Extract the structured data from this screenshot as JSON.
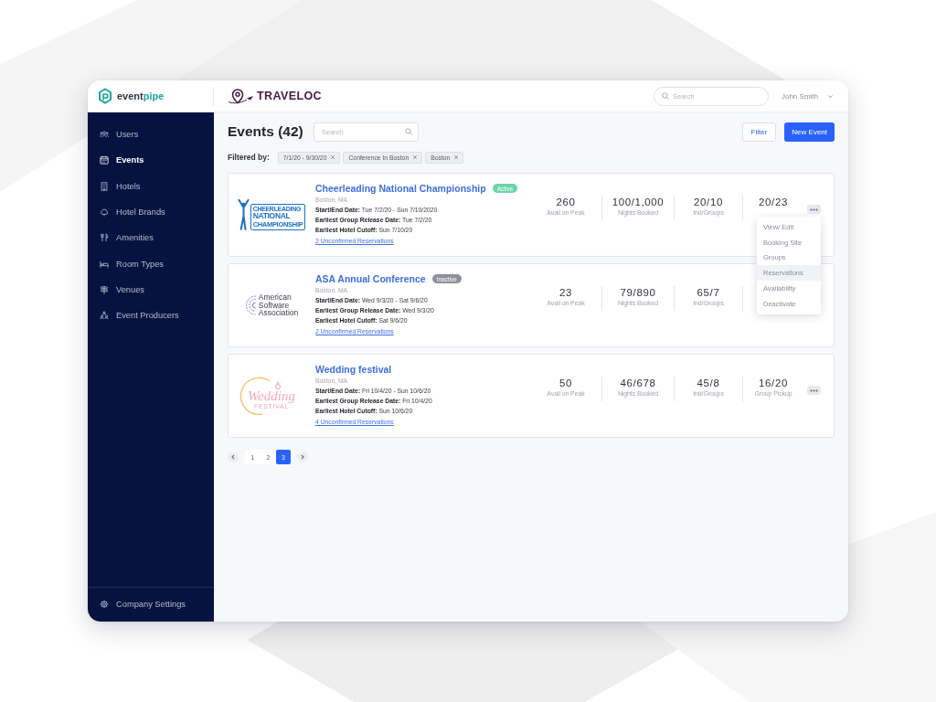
{
  "app_logo": {
    "parts": [
      "event",
      "pipe"
    ]
  },
  "client_logo": {
    "name": "TRAVELOC"
  },
  "header": {
    "search": {
      "placeholder": "Search"
    },
    "user": "John Smith"
  },
  "sidebar": {
    "items": [
      {
        "label": "Users",
        "kind": "users",
        "selected": false
      },
      {
        "label": "Events",
        "kind": "events",
        "selected": true
      },
      {
        "label": "Hotels",
        "kind": "hotels",
        "selected": false
      },
      {
        "label": "Hotel Brands",
        "kind": "hotel_brands",
        "selected": false
      },
      {
        "label": "Amenities",
        "kind": "amenities",
        "selected": false
      },
      {
        "label": "Room Types",
        "kind": "room_types",
        "selected": false
      },
      {
        "label": "Venues",
        "kind": "venues",
        "selected": false
      },
      {
        "label": "Event Producers",
        "kind": "event_producers",
        "selected": false
      }
    ],
    "footer": {
      "label": "Company Settings",
      "kind": "settings"
    }
  },
  "page": {
    "title": "Events (42)",
    "search": {
      "placeholder": "Search"
    },
    "filter_button": "Filter",
    "new_button": "New Event"
  },
  "filters": {
    "label": "Filtered by:",
    "chips": [
      "7/1/20 - 9/30/20",
      "Conference In Boston",
      "Boston"
    ]
  },
  "events": [
    {
      "logo": {
        "kind": "cheer",
        "texts": [
          "CHEERLEADING",
          "NATIONAL",
          "CHAMPIONSHIP"
        ]
      },
      "title": "Cheerleading National Championship",
      "status": {
        "label": "Active",
        "kind": "active"
      },
      "location": "Boston, MA",
      "details": [
        "**Start/End Date:** Tue 7/2/20 - Sun 7/10/2020",
        "**Earliest Group Release Date:** Tue 7/2/20",
        "**Earliest Hotel Cutoff:** Sun 7/10/20"
      ],
      "link": "2 Unconfirmed Reservations",
      "stats": [
        {
          "value": "260",
          "label": "Avail on Peak"
        },
        {
          "value": "100/1,000",
          "label": "Nights Booked"
        },
        {
          "value": "20/10",
          "label": "Ind/Groups"
        },
        {
          "value": "20/23"
        }
      ],
      "more_button": true,
      "menu": {
        "open": true,
        "items": [
          {
            "label": "View/ Edit",
            "selected": false
          },
          {
            "label": "Booking Site",
            "selected": false
          },
          {
            "label": "Groups",
            "selected": false
          },
          {
            "label": "Reservations",
            "selected": true
          },
          {
            "label": "Availability",
            "selected": false
          },
          {
            "label": "Deactivate",
            "selected": false
          }
        ]
      }
    },
    {
      "logo": {
        "kind": "association",
        "texts": [
          "American Software Association"
        ]
      },
      "title": "ASA Annual Conference",
      "status": {
        "label": "Inactive",
        "kind": "inactive"
      },
      "location": "Boston, MA",
      "details": [
        "**Start/End Date:** Wed 9/3/20 - Sat 9/6/20",
        "**Earliest Group Release Date:** Wed 9/3/20",
        "**Earliest Hotel Cutoff:** Sat 9/6/20"
      ],
      "link": "2 Unconfirmed Reservations",
      "stats": [
        {
          "value": "23",
          "label": "Avail on Peak"
        },
        {
          "value": "79/890",
          "label": "Nights Booked"
        },
        {
          "value": "65/7",
          "label": "Ind/Groups"
        }
      ],
      "more_button": false
    },
    {
      "logo": {
        "kind": "wedding",
        "texts": [
          "Wedding",
          "FESTIVAL"
        ]
      },
      "title": "Wedding festival",
      "location": "Boston, MA",
      "details": [
        "**Start/End Date:** Fri 10/4/20 - Sun 10/6/20",
        "**Earliest Group Release Date:** Fri 10/4/20",
        "**Earliest Hotel Cutoff:** Sun 10/6/20"
      ],
      "link": "4 Unconfirmed Reservations",
      "stats": [
        {
          "value": "50",
          "label": "Avail on Peak"
        },
        {
          "value": "46/678",
          "label": "Nights Booked"
        },
        {
          "value": "45/8",
          "label": "Ind/Groups"
        },
        {
          "value": "16/20",
          "label": "Group Pickup"
        }
      ],
      "more_button": true
    }
  ],
  "pagination": {
    "pages": [
      {
        "label": "1",
        "selected": false
      },
      {
        "label": "2",
        "selected": false
      },
      {
        "label": "3",
        "selected": true
      }
    ]
  }
}
